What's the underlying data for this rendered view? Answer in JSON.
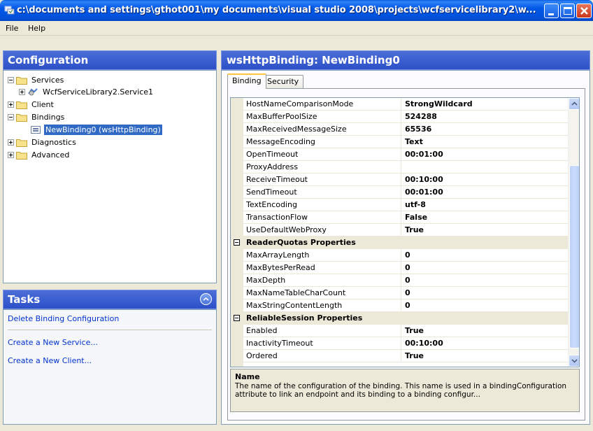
{
  "window": {
    "title": "c:\\documents and settings\\gthot001\\my documents\\visual studio 2008\\projects\\wcfservicelibrary2\\w..."
  },
  "menu": {
    "items": [
      "File",
      "Help"
    ]
  },
  "left": {
    "header": "Configuration",
    "tree": [
      {
        "label": "Services"
      },
      {
        "label": "WcfServiceLibrary2.Service1"
      },
      {
        "label": "Client"
      },
      {
        "label": "Bindings"
      },
      {
        "label": "NewBinding0 (wsHttpBinding)"
      },
      {
        "label": "Diagnostics"
      },
      {
        "label": "Advanced"
      }
    ]
  },
  "tasks": {
    "header": "Tasks",
    "links": [
      "Delete Binding Configuration",
      "Create a New Service...",
      "Create a New Client..."
    ]
  },
  "right": {
    "header": "wsHttpBinding: NewBinding0",
    "tabs": [
      "Binding",
      "Security"
    ],
    "rows": [
      {
        "name": "HostNameComparisonMode",
        "value": "StrongWildcard"
      },
      {
        "name": "MaxBufferPoolSize",
        "value": "524288"
      },
      {
        "name": "MaxReceivedMessageSize",
        "value": "65536"
      },
      {
        "name": "MessageEncoding",
        "value": "Text"
      },
      {
        "name": "OpenTimeout",
        "value": "00:01:00"
      },
      {
        "name": "ProxyAddress",
        "value": ""
      },
      {
        "name": "ReceiveTimeout",
        "value": "00:10:00"
      },
      {
        "name": "SendTimeout",
        "value": "00:01:00"
      },
      {
        "name": "TextEncoding",
        "value": "utf-8"
      },
      {
        "name": "TransactionFlow",
        "value": "False"
      },
      {
        "name": "UseDefaultWebProxy",
        "value": "True"
      }
    ],
    "readerquotas": {
      "title": "ReaderQuotas Properties",
      "rows": [
        {
          "name": "MaxArrayLength",
          "value": "0"
        },
        {
          "name": "MaxBytesPerRead",
          "value": "0"
        },
        {
          "name": "MaxDepth",
          "value": "0"
        },
        {
          "name": "MaxNameTableCharCount",
          "value": "0"
        },
        {
          "name": "MaxStringContentLength",
          "value": "0"
        }
      ]
    },
    "reliable": {
      "title": "ReliableSession Properties",
      "rows": [
        {
          "name": "Enabled",
          "value": "True"
        },
        {
          "name": "InactivityTimeout",
          "value": "00:10:00"
        },
        {
          "name": "Ordered",
          "value": "True"
        }
      ]
    },
    "description": {
      "title": "Name",
      "text": "The name of the configuration of the binding. This name is used in a bindingConfiguration attribute to link an endpoint and its binding to a binding configur..."
    }
  }
}
